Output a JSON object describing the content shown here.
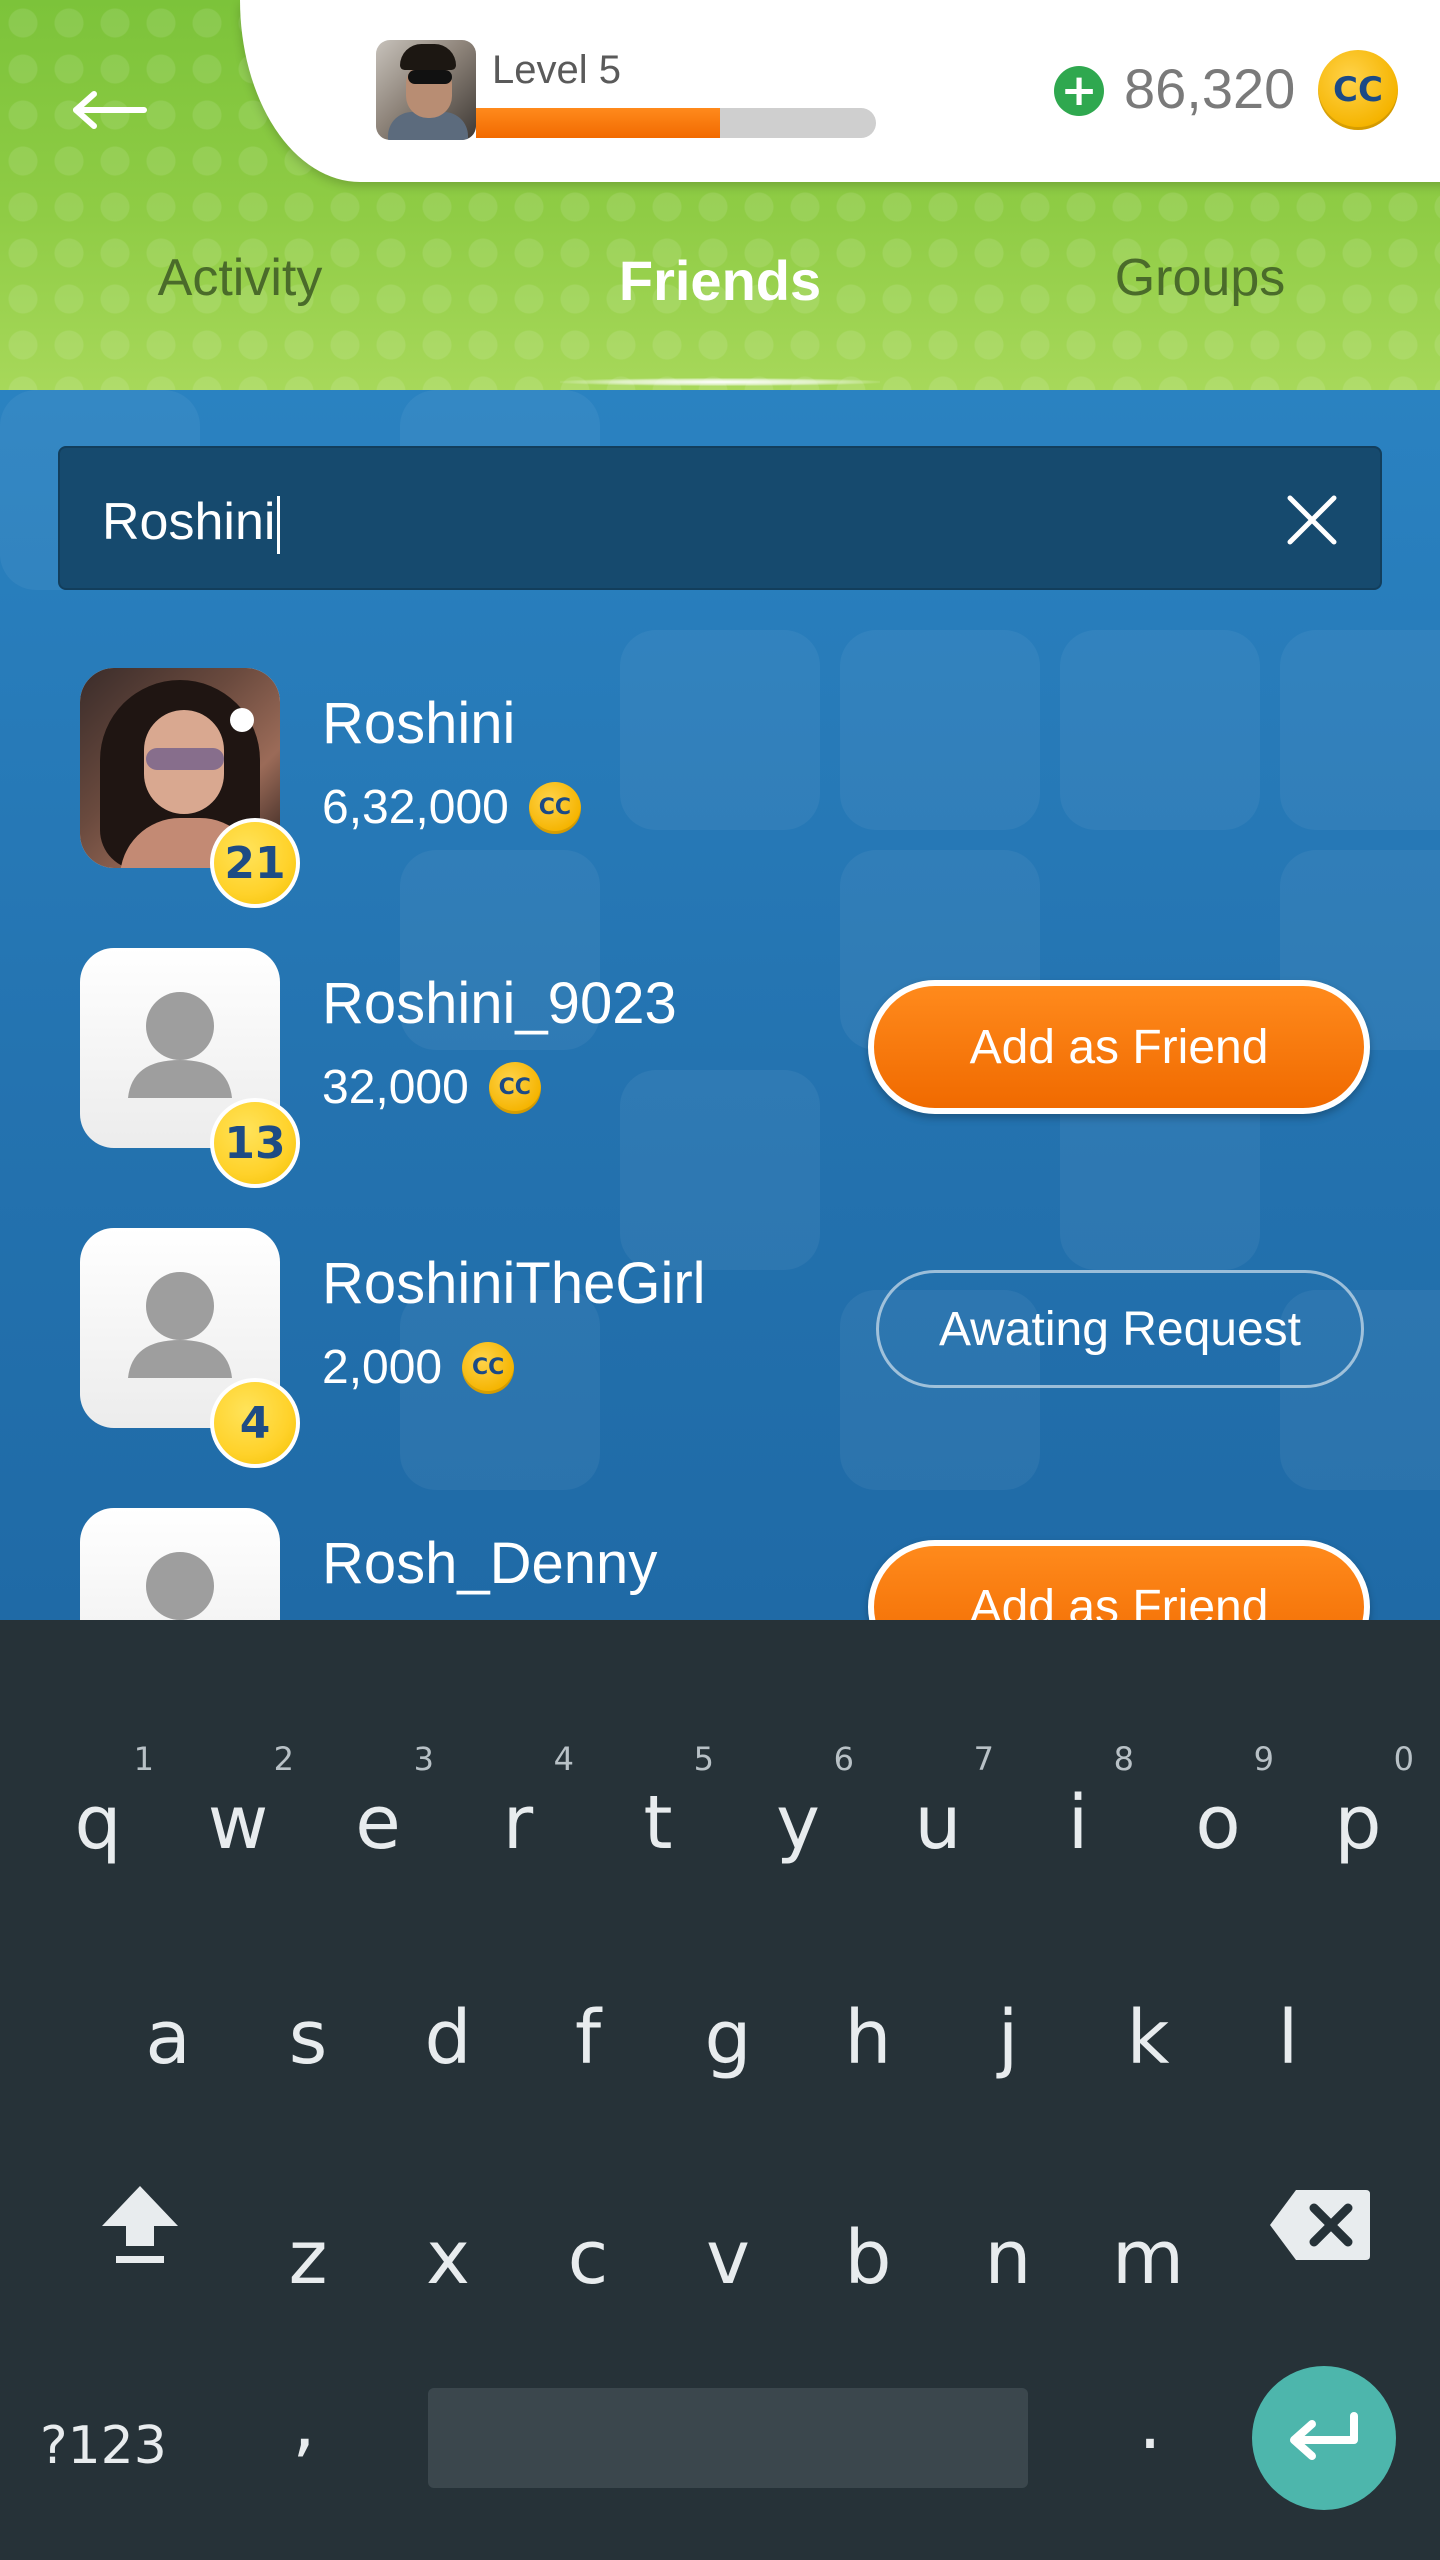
{
  "header": {
    "level_label": "Level 5",
    "level_progress_fraction": 0.61,
    "coins": "86,320",
    "coin_symbol": "CC"
  },
  "tabs": [
    {
      "label": "Activity",
      "active": false
    },
    {
      "label": "Friends",
      "active": true
    },
    {
      "label": "Groups",
      "active": false
    }
  ],
  "search": {
    "value": "Roshini"
  },
  "results": [
    {
      "name": "Roshini",
      "coins": "6,32,000",
      "level": "21",
      "action": ""
    },
    {
      "name": "Roshini_9023",
      "coins": "32,000",
      "level": "13",
      "action": "Add as Friend"
    },
    {
      "name": "RoshiniTheGirl",
      "coins": "2,000",
      "level": "4",
      "action": "Awating Request"
    },
    {
      "name": "Rosh_Denny",
      "coins": "",
      "level": "",
      "action": "Add as Friend"
    }
  ],
  "keyboard": {
    "row1": [
      {
        "key": "q",
        "num": "1"
      },
      {
        "key": "w",
        "num": "2"
      },
      {
        "key": "e",
        "num": "3"
      },
      {
        "key": "r",
        "num": "4"
      },
      {
        "key": "t",
        "num": "5"
      },
      {
        "key": "y",
        "num": "6"
      },
      {
        "key": "u",
        "num": "7"
      },
      {
        "key": "i",
        "num": "8"
      },
      {
        "key": "o",
        "num": "9"
      },
      {
        "key": "p",
        "num": "0"
      }
    ],
    "row2": [
      "a",
      "s",
      "d",
      "f",
      "g",
      "h",
      "j",
      "k",
      "l"
    ],
    "row3": [
      "z",
      "x",
      "c",
      "v",
      "b",
      "n",
      "m"
    ],
    "symbols_label": "?123",
    "comma": ",",
    "period": "."
  },
  "colors": {
    "header_green": "#8fcc45",
    "content_blue": "#2473b0",
    "accent_orange": "#f27a0a",
    "coin_gold": "#f5b400",
    "keyboard_bg": "#263238",
    "enter_teal": "#4db6ac"
  }
}
